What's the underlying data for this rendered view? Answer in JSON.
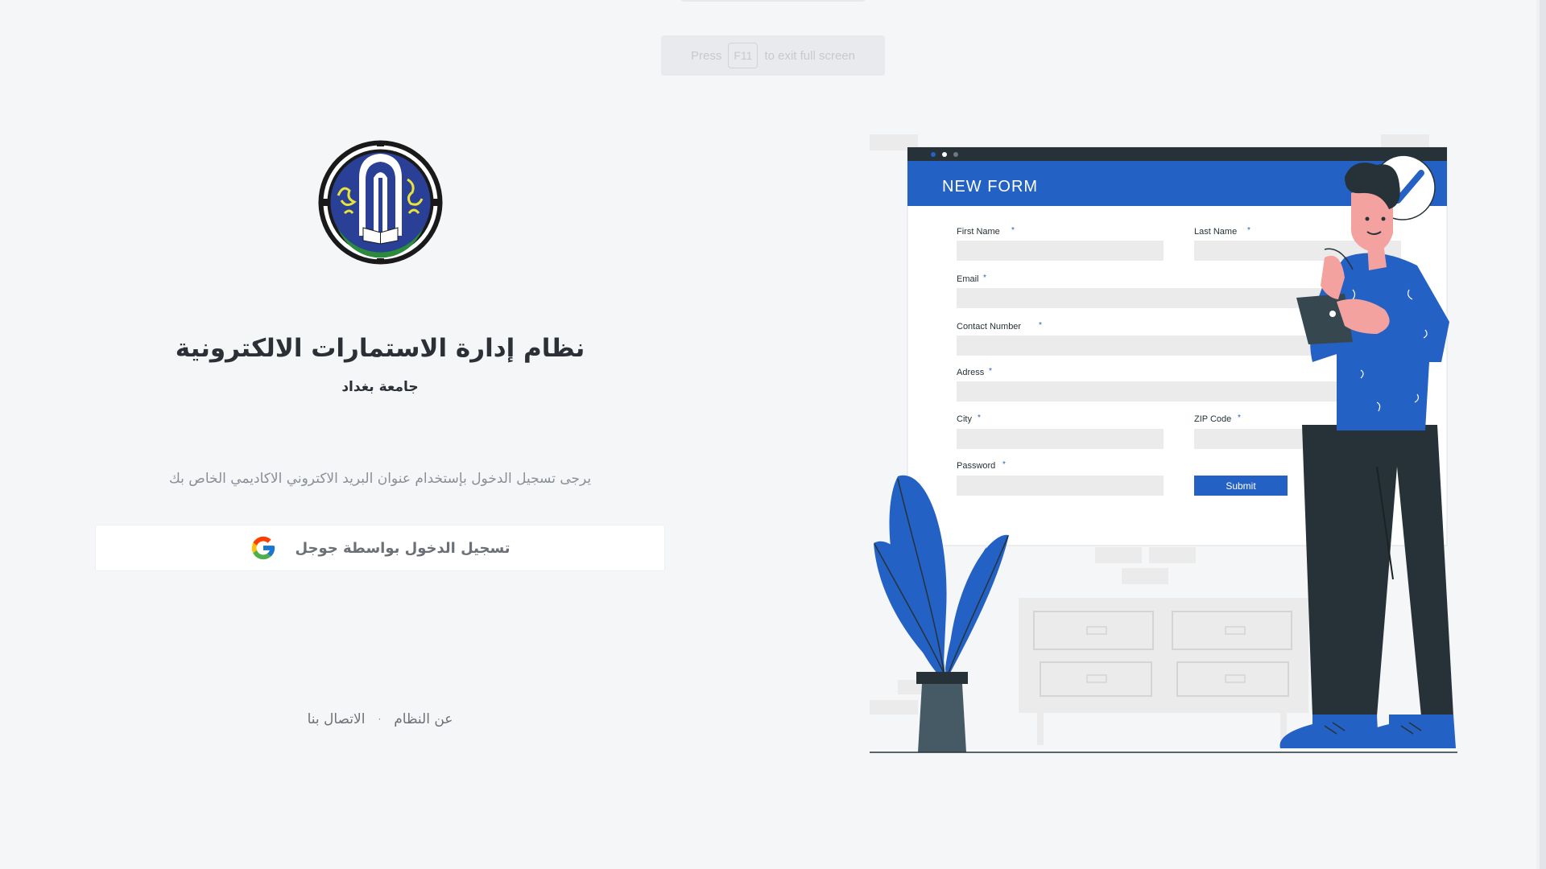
{
  "fullscreen_notice": {
    "press": "Press",
    "key": "F11",
    "rest": "to exit full screen"
  },
  "left": {
    "title": "نظام إدارة الاستمارات الالكترونية",
    "subtitle": "جامعة بغداد",
    "instruction": "يرجى تسجيل الدخول بإستخدام عنوان البريد الاكتروني الاكاديمي الخاص بك",
    "google_button_label": "تسجيل الدخول بواسطة جوجل",
    "footer": {
      "about": "عن النظام",
      "separator": "·",
      "contact": "الاتصال بنا"
    }
  },
  "illustration": {
    "form_title": "NEW FORM",
    "fields": {
      "first_name": "First Name",
      "last_name": "Last Name",
      "email": "Email",
      "contact": "Contact Number",
      "address": "Adress",
      "city": "City",
      "zip": "ZIP Code",
      "password": "Password"
    },
    "required_mark": "*",
    "submit": "Submit"
  },
  "colors": {
    "background": "#f5f6f8",
    "brand_blue": "#2461c4",
    "dark_navy": "#263238",
    "logo_blue": "#2a3f96",
    "logo_green": "#2b8a3e"
  },
  "icons": [
    "university-seal-logo",
    "google-icon",
    "check-icon"
  ]
}
